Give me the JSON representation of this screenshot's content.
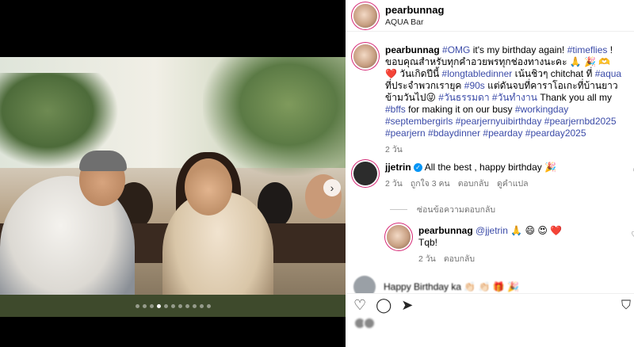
{
  "post": {
    "username": "pearbunnag",
    "location": "AQUA Bar",
    "carousel": {
      "total": 11,
      "active": 3
    }
  },
  "caption": {
    "user": "pearbunnag",
    "parts": [
      {
        "t": "#OMG",
        "tag": true
      },
      {
        "t": " it's my birthday again! ",
        "tag": false
      },
      {
        "t": "#timeflies",
        "tag": true
      },
      {
        "t": " ! ขอบคุณสำหรับทุกคำอวยพรทุกช่องทางนะคะ 🙏 🎉 🫶 ❤️ วันเกิดปีนี้ ",
        "tag": false
      },
      {
        "t": "#longtabledinner",
        "tag": true
      },
      {
        "t": " เน้นชิวๆ chitchat ที่ ",
        "tag": false
      },
      {
        "t": "#aqua",
        "tag": true
      },
      {
        "t": " ที่ประจำพวกเรายุค ",
        "tag": false
      },
      {
        "t": "#90s",
        "tag": true
      },
      {
        "t": " แต่ดันจบที่คาราโอเกะที่บ้านยาวข้ามวันไป😜 ",
        "tag": false
      },
      {
        "t": "#วันธรรมดา",
        "tag": true
      },
      {
        "t": " ",
        "tag": false
      },
      {
        "t": "#วันทำงาน",
        "tag": true
      },
      {
        "t": " Thank you all my ",
        "tag": false
      },
      {
        "t": "#bffs",
        "tag": true
      },
      {
        "t": " for making it on our busy ",
        "tag": false
      },
      {
        "t": "#workingday #septembergirls #pearjernyuibirthday #pearjernbd2025 #pearjern #bdaydinner #pearday #pearday2025",
        "tag": true
      }
    ],
    "time": "2 วัน"
  },
  "comments": [
    {
      "user": "jjetrin",
      "verified": true,
      "text": "All the best , happy birthday 🎉",
      "time": "2 วัน",
      "likes": "ถูกใจ 3 คน",
      "reply": "ตอบกลับ",
      "translate": "ดูคำแปล"
    }
  ],
  "replies_toggle": "ซ่อนข้อความตอบกลับ",
  "reply_comment": {
    "user": "pearbunnag",
    "mention": "@jjetrin",
    "text": " 🙏 😄 😍 ❤️",
    "line2": "Tqb!",
    "time": "2 วัน",
    "reply": "ตอบกลับ"
  },
  "blurred_comment": {
    "text": "Happy Birthday ka 👏🏻 👏🏻 🎁 🎉"
  },
  "icons": [
    "heart-icon",
    "comment-icon",
    "share-icon",
    "bookmark-icon",
    "chevron-right-icon",
    "verified-icon"
  ],
  "colors": {
    "hashtag": "#3b4ba8",
    "verified": "#0095f6",
    "meta": "#737373"
  }
}
